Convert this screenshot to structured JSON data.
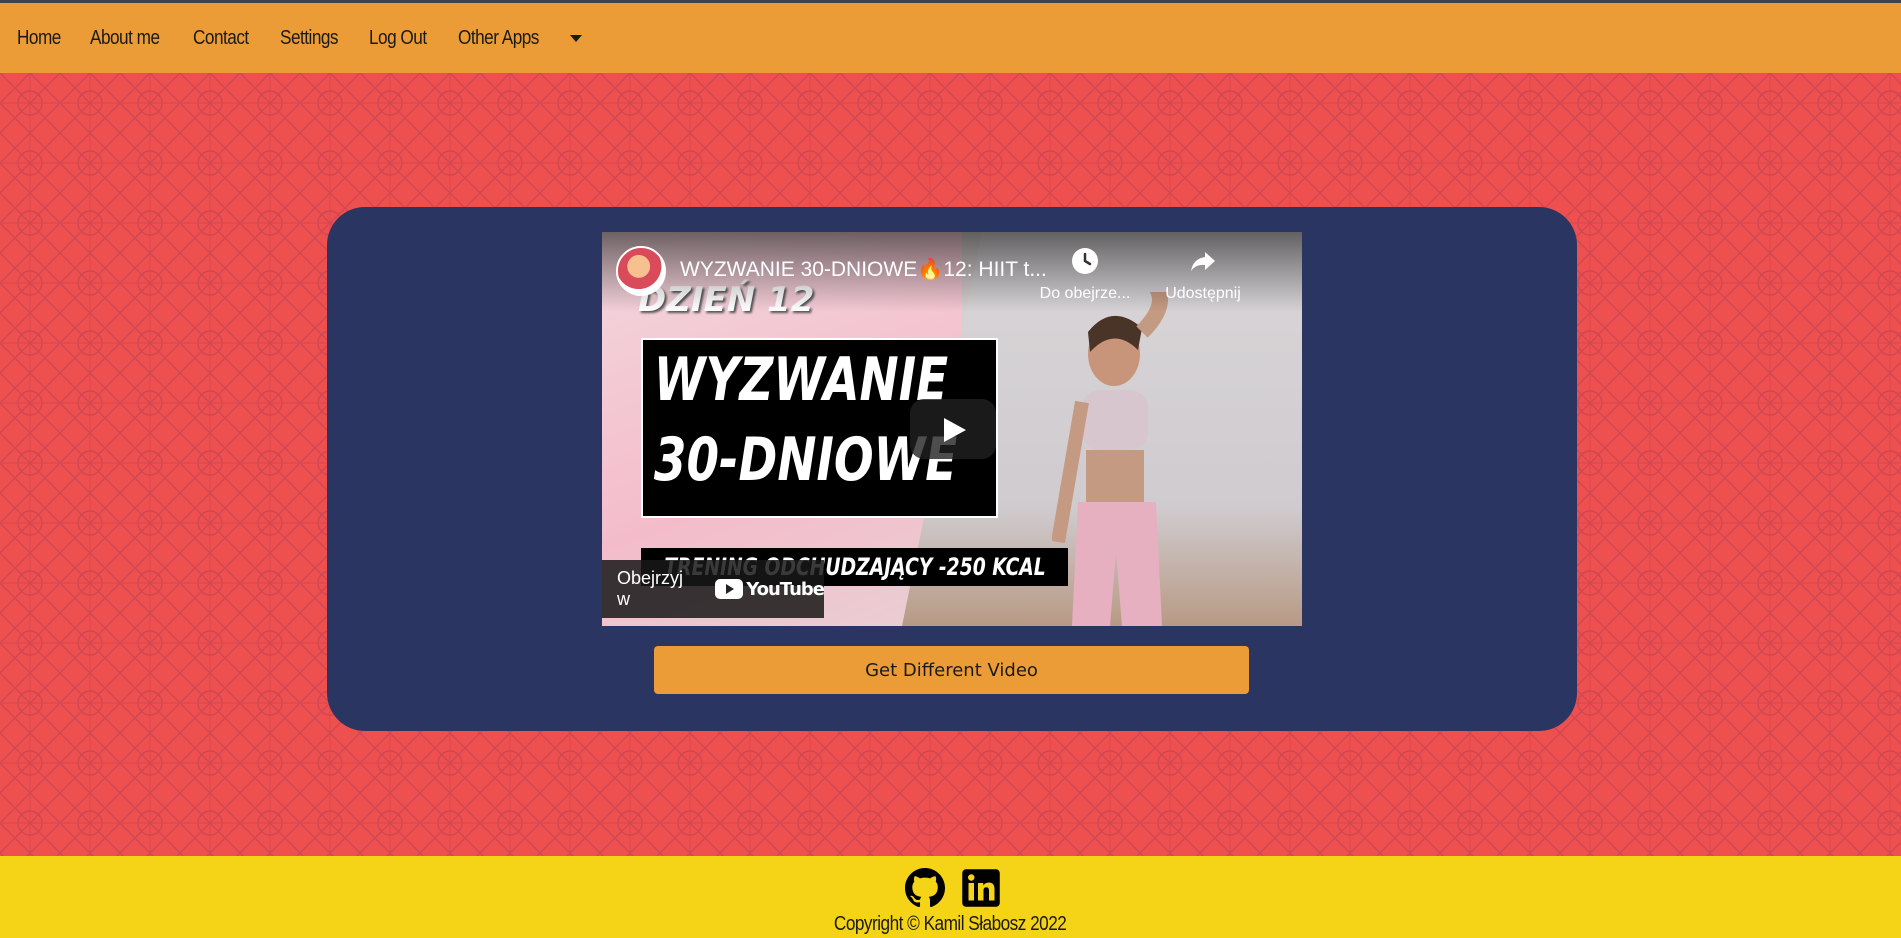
{
  "nav": {
    "items": [
      {
        "label": "Home"
      },
      {
        "label": "About me"
      },
      {
        "label": "Contact"
      },
      {
        "label": "Settings"
      },
      {
        "label": "Log Out"
      }
    ],
    "dropdown_label": "Other Apps"
  },
  "video": {
    "title": "WYZWANIE 30-DNIOWE🔥12: HIIT t...",
    "watch_later_label": "Do obejrze...",
    "share_label": "Udostępnij",
    "thumbnail_day": "DZIEŃ 12",
    "thumbnail_title_line1": "WYZWANIE",
    "thumbnail_title_line2": "30-DNIOWE",
    "thumbnail_subtitle": "TRENING ODCHUDZAJĄCY  -250 KCAL",
    "watch_on_label": "Obejrzyj w",
    "youtube_word": "YouTube"
  },
  "actions": {
    "different_video_label": "Get Different Video"
  },
  "footer": {
    "copyright": "Copyright © Kamil Słabosz 2022",
    "icons": [
      "github-icon",
      "linkedin-icon"
    ]
  },
  "colors": {
    "navbar": "#ec9c37",
    "background": "#ee4f4f",
    "card": "#2b3562",
    "button": "#ec9c37",
    "footer": "#f5d316"
  }
}
